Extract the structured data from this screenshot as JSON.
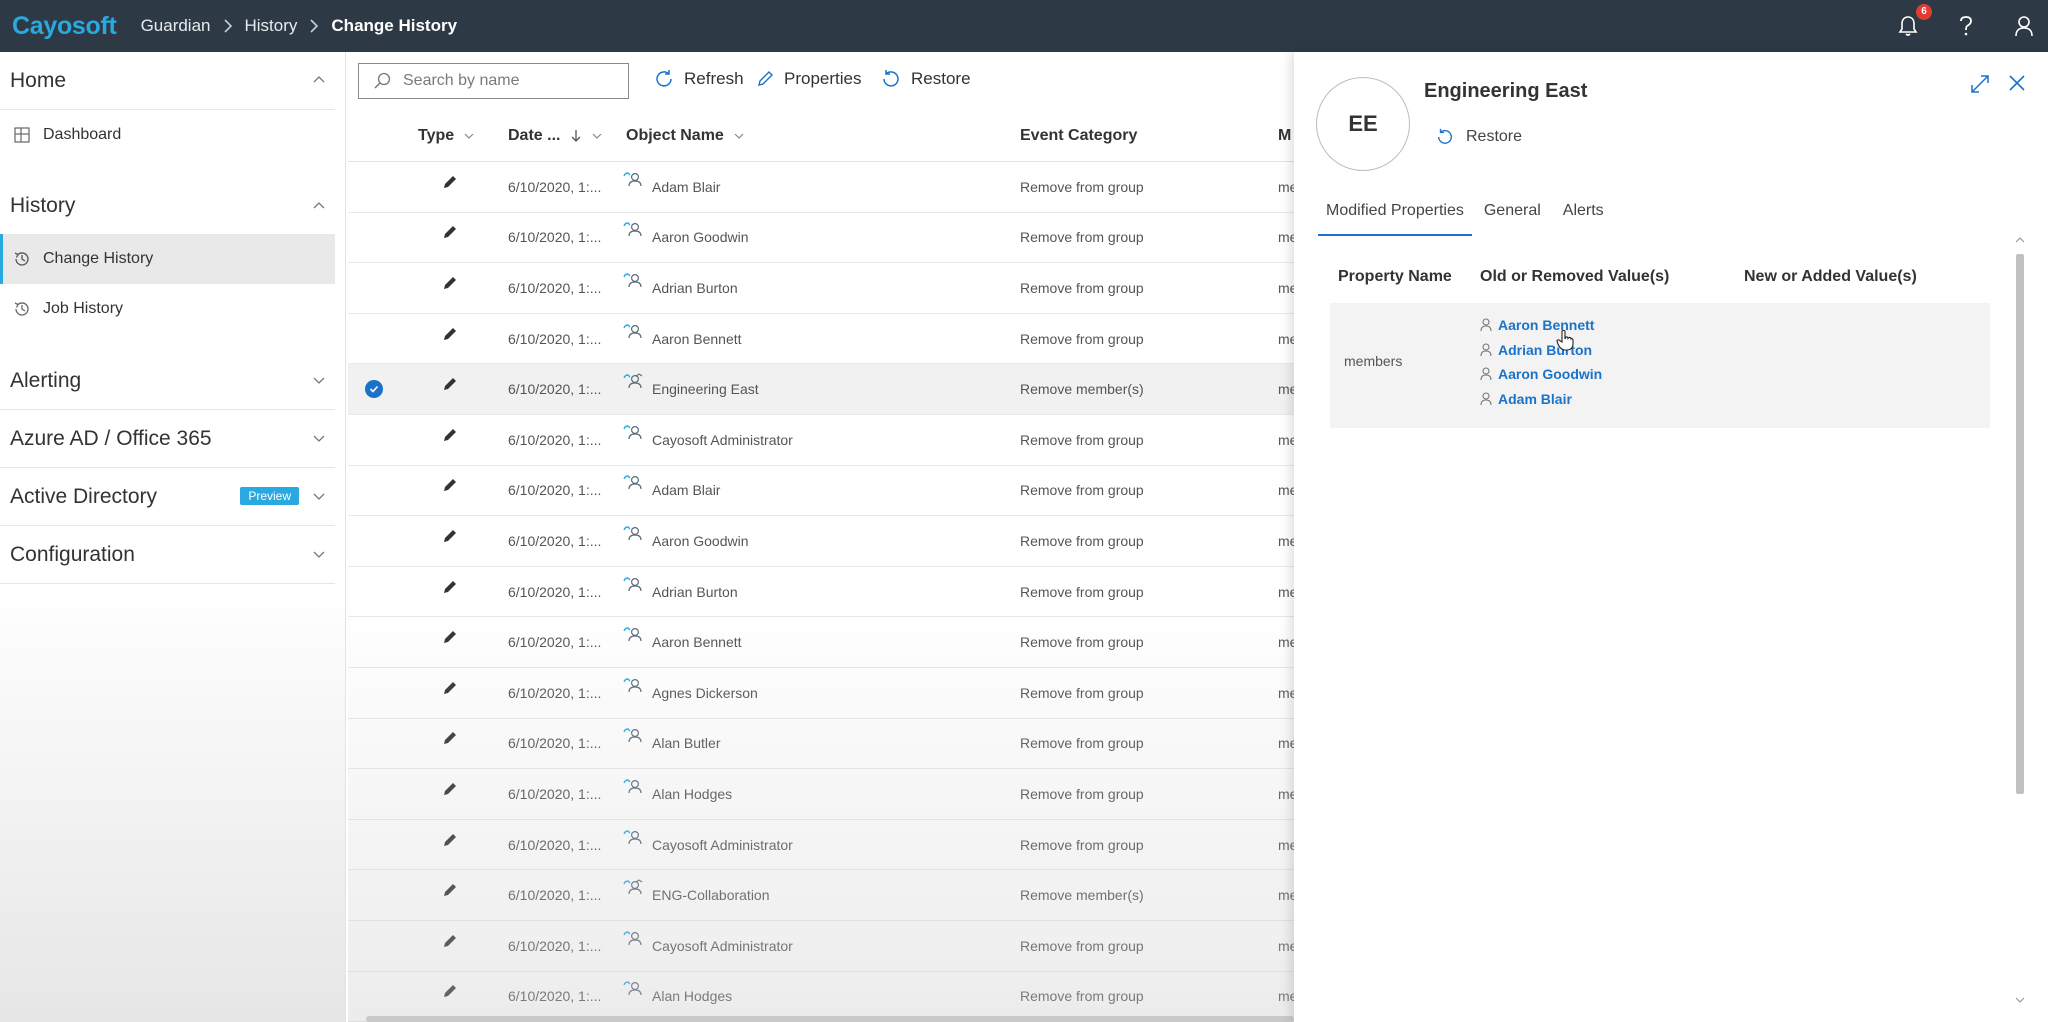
{
  "topbar": {
    "brand": "Cayosoft",
    "breadcrumb": [
      "Guardian",
      "History",
      "Change History"
    ],
    "notification_count": "6"
  },
  "sidebar": {
    "sections": [
      {
        "label": "Home",
        "expanded": true,
        "items": [
          {
            "label": "Dashboard",
            "icon": "dashboard-icon"
          }
        ]
      },
      {
        "label": "History",
        "expanded": true,
        "items": [
          {
            "label": "Change History",
            "icon": "change-history-icon",
            "active": true
          },
          {
            "label": "Job History",
            "icon": "job-history-icon"
          }
        ]
      },
      {
        "label": "Alerting",
        "expanded": false
      },
      {
        "label": "Azure AD / Office 365",
        "expanded": false
      },
      {
        "label": "Active Directory",
        "expanded": false,
        "badge": "Preview"
      },
      {
        "label": "Configuration",
        "expanded": false
      }
    ]
  },
  "toolbar": {
    "search_placeholder": "Search by name",
    "refresh_label": "Refresh",
    "properties_label": "Properties",
    "restore_label": "Restore"
  },
  "table": {
    "columns": {
      "type": "Type",
      "date": "Date ...",
      "object": "Object Name",
      "event": "Event Category",
      "m": "M"
    },
    "rows": [
      {
        "date": "6/10/2020, 1:...",
        "object": "Adam Blair",
        "event": "Remove from group",
        "m": "me",
        "kind": "user"
      },
      {
        "date": "6/10/2020, 1:...",
        "object": "Aaron Goodwin",
        "event": "Remove from group",
        "m": "me",
        "kind": "user"
      },
      {
        "date": "6/10/2020, 1:...",
        "object": "Adrian Burton",
        "event": "Remove from group",
        "m": "me",
        "kind": "user"
      },
      {
        "date": "6/10/2020, 1:...",
        "object": "Aaron Bennett",
        "event": "Remove from group",
        "m": "me",
        "kind": "user"
      },
      {
        "date": "6/10/2020, 1:...",
        "object": "Engineering East",
        "event": "Remove member(s)",
        "m": "me",
        "kind": "group",
        "selected": true
      },
      {
        "date": "6/10/2020, 1:...",
        "object": "Cayosoft Administrator",
        "event": "Remove from group",
        "m": "me",
        "kind": "user"
      },
      {
        "date": "6/10/2020, 1:...",
        "object": "Adam Blair",
        "event": "Remove from group",
        "m": "me",
        "kind": "user"
      },
      {
        "date": "6/10/2020, 1:...",
        "object": "Aaron Goodwin",
        "event": "Remove from group",
        "m": "me",
        "kind": "user"
      },
      {
        "date": "6/10/2020, 1:...",
        "object": "Adrian Burton",
        "event": "Remove from group",
        "m": "me",
        "kind": "user"
      },
      {
        "date": "6/10/2020, 1:...",
        "object": "Aaron Bennett",
        "event": "Remove from group",
        "m": "me",
        "kind": "user"
      },
      {
        "date": "6/10/2020, 1:...",
        "object": "Agnes Dickerson",
        "event": "Remove from group",
        "m": "me",
        "kind": "user"
      },
      {
        "date": "6/10/2020, 1:...",
        "object": "Alan Butler",
        "event": "Remove from group",
        "m": "me",
        "kind": "user"
      },
      {
        "date": "6/10/2020, 1:...",
        "object": "Alan Hodges",
        "event": "Remove from group",
        "m": "me",
        "kind": "user"
      },
      {
        "date": "6/10/2020, 1:...",
        "object": "Cayosoft Administrator",
        "event": "Remove from group",
        "m": "me",
        "kind": "user"
      },
      {
        "date": "6/10/2020, 1:...",
        "object": "ENG-Collaboration",
        "event": "Remove member(s)",
        "m": "me",
        "kind": "group"
      },
      {
        "date": "6/10/2020, 1:...",
        "object": "Cayosoft Administrator",
        "event": "Remove from group",
        "m": "me",
        "kind": "user"
      },
      {
        "date": "6/10/2020, 1:...",
        "object": "Alan Hodges",
        "event": "Remove from group",
        "m": "me",
        "kind": "user"
      }
    ]
  },
  "panel": {
    "initials": "EE",
    "title": "Engineering East",
    "restore_label": "Restore",
    "tabs": [
      "Modified Properties",
      "General",
      "Alerts"
    ],
    "grid_headers": {
      "property": "Property Name",
      "old": "Old or Removed Value(s)",
      "new": "New or Added Value(s)"
    },
    "property": {
      "name": "members",
      "old_values": [
        "Aaron Bennett",
        "Adrian Burton",
        "Aaron Goodwin",
        "Adam Blair"
      ]
    }
  },
  "colors": {
    "topbar": "#2d3a46",
    "brand": "#2aa8e0",
    "link": "#1a73c8",
    "badge": "#e03c31"
  }
}
